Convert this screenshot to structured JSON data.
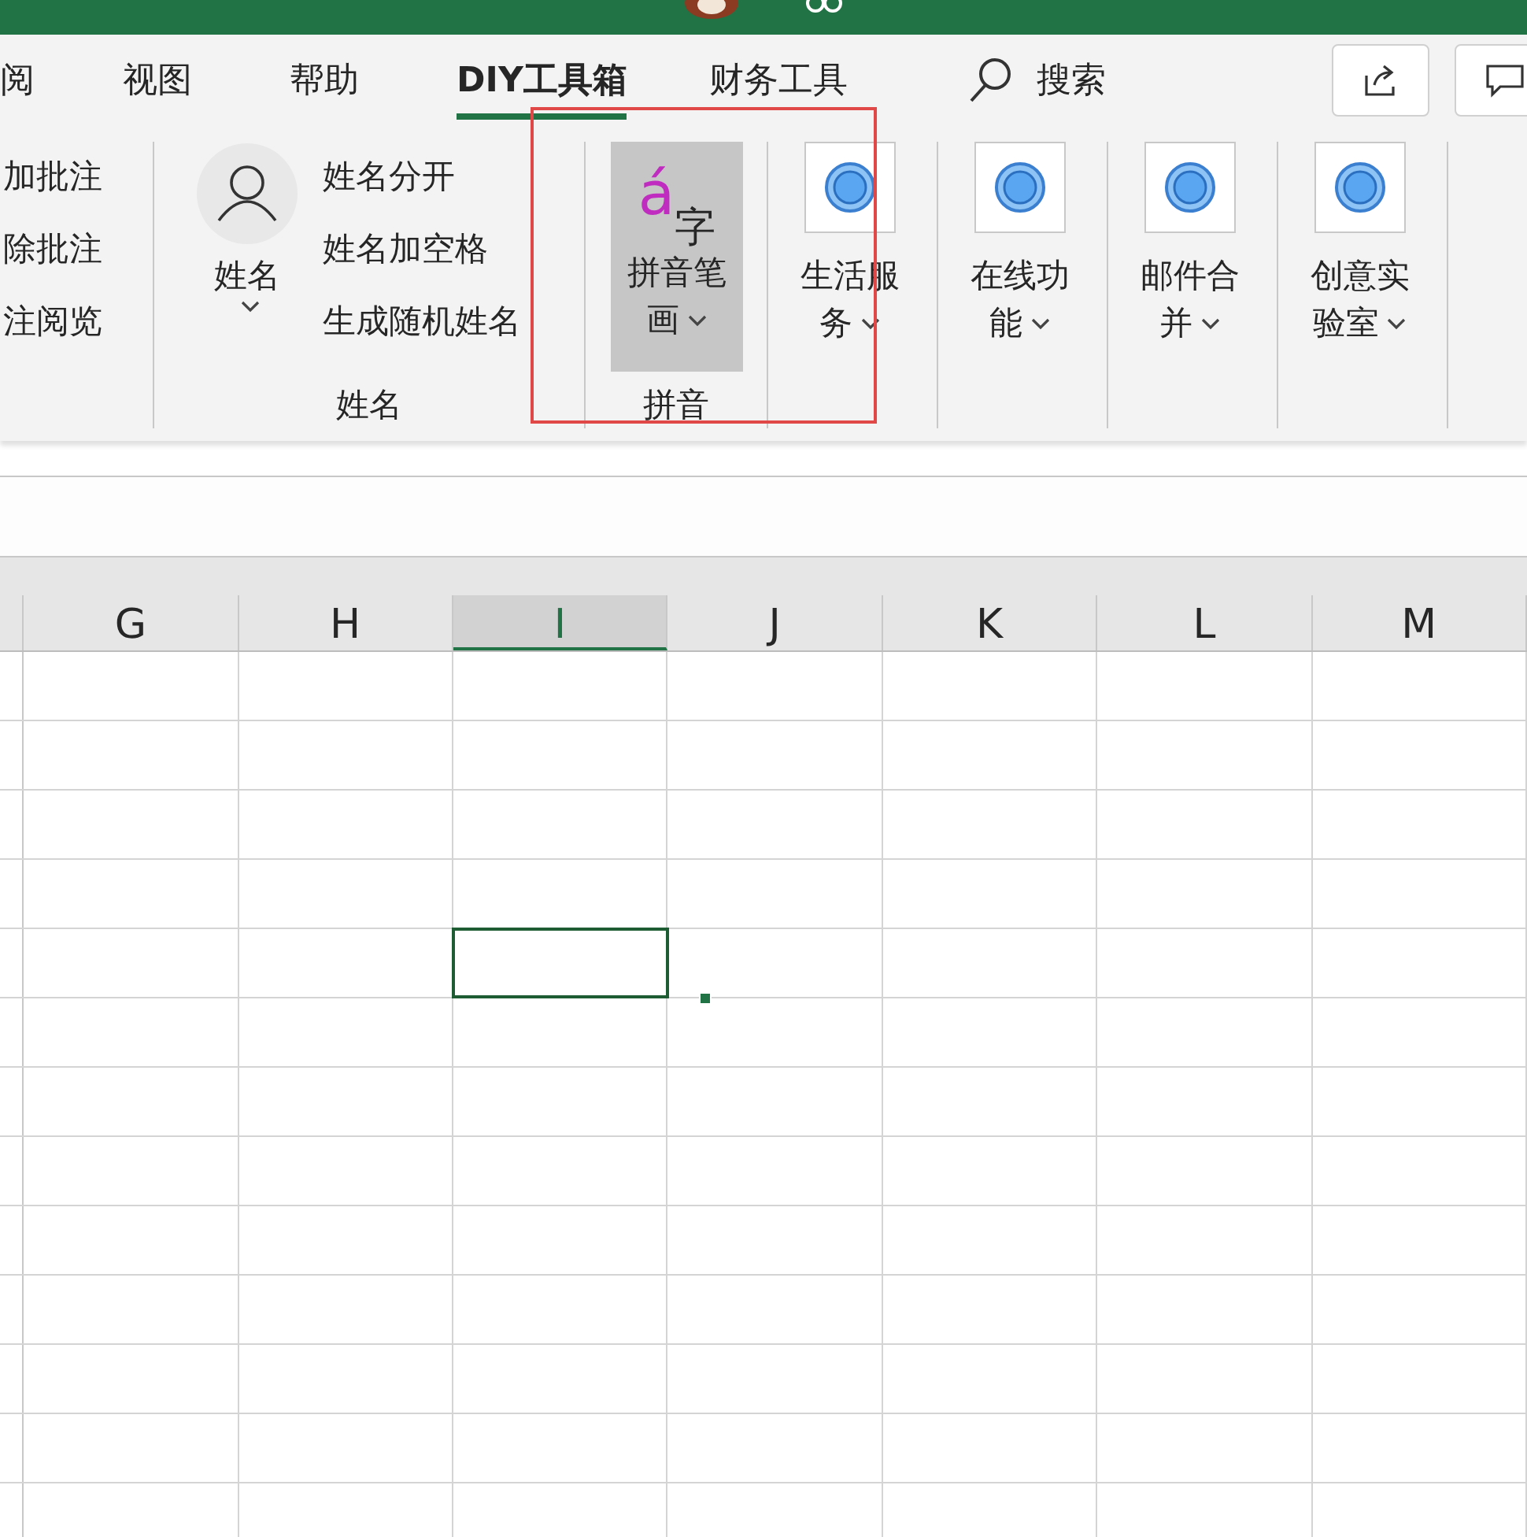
{
  "tabs": [
    {
      "label": "阅",
      "selected": false
    },
    {
      "label": "视图",
      "selected": false
    },
    {
      "label": "帮助",
      "selected": false
    },
    {
      "label": "DIY工具箱",
      "selected": true
    },
    {
      "label": "财务工具",
      "selected": false
    }
  ],
  "search": {
    "label": "搜索"
  },
  "ribbon": {
    "groups": [
      {
        "kind": "list",
        "items": [
          "加批注",
          "除批注",
          "注阅览"
        ]
      },
      {
        "kind": "person",
        "button": "姓名",
        "items": [
          "姓名分开",
          "姓名加空格",
          "生成随机姓名"
        ],
        "label": "姓名"
      },
      {
        "kind": "glyph",
        "button": "拼音笔画",
        "glyphs": [
          "á",
          "字"
        ],
        "pressed": true,
        "label": "拼音"
      },
      {
        "kind": "circle",
        "button": "生活服务"
      },
      {
        "kind": "circle",
        "button": "在线功能"
      },
      {
        "kind": "circle",
        "button": "邮件合并"
      },
      {
        "kind": "circle",
        "button": "创意实验室"
      }
    ]
  },
  "columns": [
    {
      "label": "G",
      "selected": false
    },
    {
      "label": "H",
      "selected": false
    },
    {
      "label": "I",
      "selected": true
    },
    {
      "label": "J",
      "selected": false
    },
    {
      "label": "K",
      "selected": false
    },
    {
      "label": "L",
      "selected": false
    },
    {
      "label": "M",
      "selected": false
    }
  ],
  "rows": [
    {
      "selected": false
    },
    {
      "selected": false
    },
    {
      "selected": false
    },
    {
      "selected": false
    },
    {
      "selected": true
    },
    {
      "selected": false
    },
    {
      "selected": false
    },
    {
      "selected": false
    },
    {
      "selected": false
    },
    {
      "selected": false
    },
    {
      "selected": false
    },
    {
      "selected": false
    },
    {
      "selected": false
    }
  ]
}
